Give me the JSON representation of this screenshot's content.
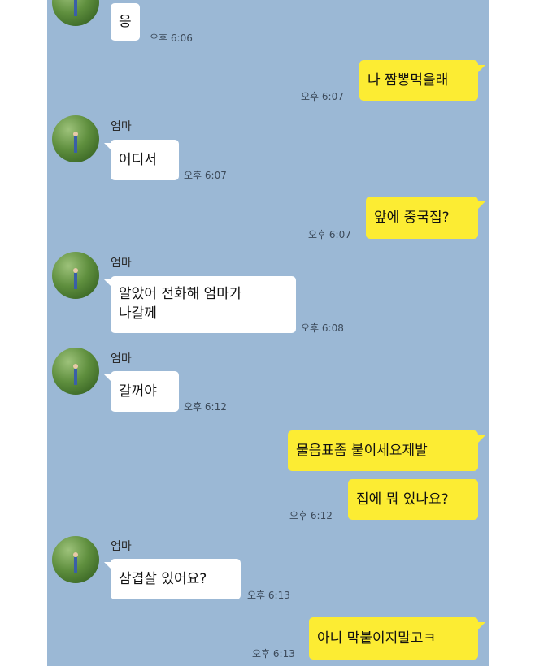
{
  "conversation": {
    "sender_name": "엄마",
    "messages": [
      {
        "from": "mom",
        "text": "응",
        "time": "오후 6:06"
      },
      {
        "from": "me",
        "text": "나 짬뽕먹을래",
        "time": "오후 6:07"
      },
      {
        "from": "mom",
        "text": "어디서",
        "time": "오후 6:07"
      },
      {
        "from": "me",
        "text": "앞에 중국집?",
        "time": "오후 6:07"
      },
      {
        "from": "mom",
        "text": "알았어 전화해 엄마가\n나갈께",
        "time": "오후 6:08"
      },
      {
        "from": "mom",
        "text": "갈꺼야",
        "time": "오후 6:12"
      },
      {
        "from": "me",
        "text": "물음표좀 붙이세요제발",
        "time": ""
      },
      {
        "from": "me",
        "text": "집에 뭐 있나요?",
        "time": "오후 6:12"
      },
      {
        "from": "mom",
        "text": "삼겹살 있어요?",
        "time": "오후 6:13"
      },
      {
        "from": "me",
        "text": "아니 막붙이지말고ㅋ",
        "time": "오후 6:13"
      }
    ]
  },
  "icons": {
    "avatar": "profile-photo-tree"
  },
  "colors": {
    "chat_background": "#9bb8d5",
    "incoming_bubble": "#ffffff",
    "outgoing_bubble": "#fcec33"
  }
}
